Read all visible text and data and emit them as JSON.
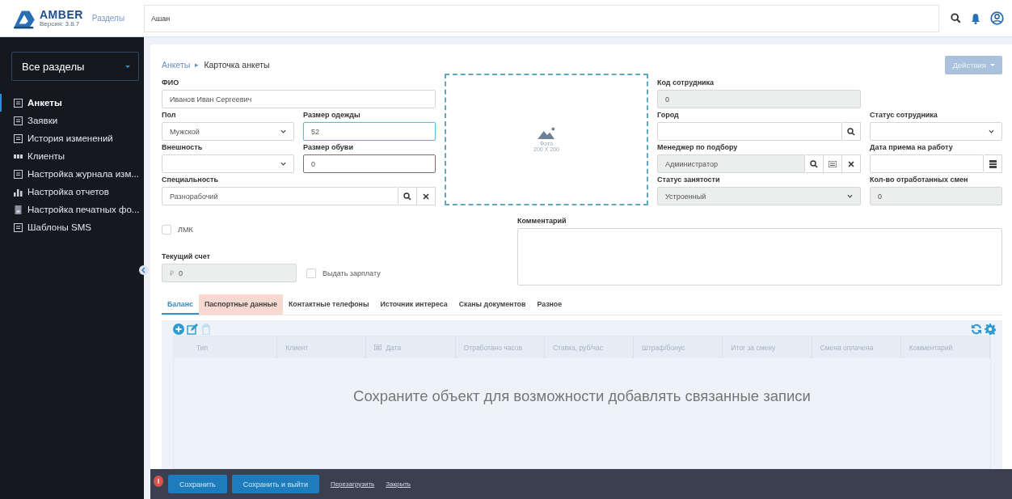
{
  "header": {
    "logo": "AMBER",
    "version": "Версия: 3.8.7",
    "sections_link": "Разделы",
    "search": {
      "value": "Ашан"
    }
  },
  "sidebar": {
    "dropdown": "Все разделы",
    "items": [
      {
        "label": "Анкеты",
        "kind": "list",
        "selected": true
      },
      {
        "label": "Заявки",
        "kind": "list",
        "selected": false
      },
      {
        "label": "История изменений",
        "kind": "list",
        "selected": false
      },
      {
        "label": "Клиенты",
        "kind": "cards",
        "selected": false
      },
      {
        "label": "Настройка журнала изм...",
        "kind": "list",
        "selected": false
      },
      {
        "label": "Настройка отчетов",
        "kind": "chart",
        "selected": false
      },
      {
        "label": "Настройка печатных фо...",
        "kind": "doc",
        "selected": false
      },
      {
        "label": "Шаблоны SMS",
        "kind": "list",
        "selected": false
      }
    ]
  },
  "breadcrumb": {
    "link": "Анкеты",
    "separator": "▸",
    "current": "Карточка анкеты"
  },
  "actions_button": {
    "label": "Действия",
    "disabled": true
  },
  "photo": {
    "caption": "Фото",
    "size": "200 X 200"
  },
  "fields": [
    {
      "label": "ФИО",
      "kind": "text",
      "value": "Иванов Иван Сергеевич",
      "disabled": false,
      "focused": false,
      "error": false
    },
    {
      "label": "Код сотрудника",
      "kind": "text",
      "value": "0",
      "disabled": true,
      "focused": false,
      "error": false
    },
    {
      "label": "Пол",
      "kind": "select",
      "value": "Мужской",
      "disabled": false,
      "focused": false,
      "error": false
    },
    {
      "label": "Размер одежды",
      "kind": "text",
      "value": "52",
      "disabled": false,
      "focused": true,
      "error": false
    },
    {
      "label": "Город",
      "kind": "lookup",
      "buttons": [
        {
          "kind": "search"
        }
      ],
      "disabled": false,
      "focused": false,
      "error": false
    },
    {
      "label": "Статус сотрудника",
      "kind": "select",
      "disabled": false,
      "focused": false,
      "error": false
    },
    {
      "label": "Внешность",
      "kind": "select",
      "disabled": false,
      "focused": false,
      "error": false
    },
    {
      "label": "Размер обуви",
      "kind": "text",
      "value": "0",
      "disabled": false,
      "focused": false,
      "error": true
    },
    {
      "label": "Менеджер по подбору",
      "kind": "lookup",
      "value": "Администратор",
      "buttons": [
        {
          "kind": "search"
        },
        {
          "kind": "list"
        },
        {
          "kind": "clear"
        }
      ],
      "disabled": true,
      "focused": false,
      "error": false
    },
    {
      "label": "Дата приема на работу",
      "kind": "lookup",
      "buttons": [
        {
          "kind": "calendar"
        }
      ],
      "disabled": false,
      "focused": false,
      "error": false
    },
    {
      "label": "Специальность",
      "kind": "lookup",
      "value": "Разнорабочий",
      "buttons": [
        {
          "kind": "search"
        },
        {
          "kind": "clear"
        }
      ],
      "disabled": false,
      "focused": false,
      "error": false
    },
    {
      "label": "Статус занятости",
      "kind": "select",
      "value": "Устроенный",
      "disabled": true,
      "focused": false,
      "error": false
    },
    {
      "label": "Кол-во отработанных смен",
      "kind": "text",
      "value": "0",
      "disabled": true,
      "focused": false,
      "error": false
    }
  ],
  "lmk": {
    "label": "ЛМК",
    "checked": false
  },
  "account": {
    "label": "Текущий счет",
    "currency": "₽",
    "value": "0",
    "disabled": true
  },
  "pay_checkbox": {
    "label": "Выдать зарплату",
    "checked": false
  },
  "comment": {
    "label": "Комментарий"
  },
  "tabs": [
    {
      "label": "Баланс",
      "selected": true,
      "error": false
    },
    {
      "label": "Паспортные данные",
      "selected": false,
      "error": true
    },
    {
      "label": "Контактные телефоны",
      "selected": false,
      "error": false
    },
    {
      "label": "Источник интереса",
      "selected": false,
      "error": false
    },
    {
      "label": "Сканы документов",
      "selected": false,
      "error": false
    },
    {
      "label": "Разное",
      "selected": false,
      "error": false
    }
  ],
  "grid": {
    "tools": [
      {
        "kind": "add",
        "disabled": false
      },
      {
        "kind": "edit",
        "disabled": false
      },
      {
        "kind": "delete",
        "disabled": true
      }
    ],
    "right_tools": [
      {
        "kind": "refresh"
      },
      {
        "kind": "settings"
      }
    ],
    "columns": [
      {
        "label": "Тип",
        "kind": "text"
      },
      {
        "label": "Клиент",
        "kind": "text"
      },
      {
        "label": "Дата",
        "kind": "date"
      },
      {
        "label": "Отработано часов",
        "kind": "text"
      },
      {
        "label": "Ставка, руб/час",
        "kind": "text"
      },
      {
        "label": "Штраф/бонус",
        "kind": "text"
      },
      {
        "label": "Итог за смену",
        "kind": "text"
      },
      {
        "label": "Смена оплачена",
        "kind": "text"
      },
      {
        "label": "Комментарий",
        "kind": "text"
      }
    ],
    "empty_message": "Сохраните объект для возможности добавлять связанные записи"
  },
  "footer": {
    "alert": "!",
    "buttons": [
      {
        "label": "Сохранить",
        "kind": "button"
      },
      {
        "label": "Сохранить и выйти",
        "kind": "button"
      },
      {
        "label": "Перезагрузить",
        "kind": "link"
      },
      {
        "label": "Закрыть",
        "kind": "link"
      }
    ]
  }
}
